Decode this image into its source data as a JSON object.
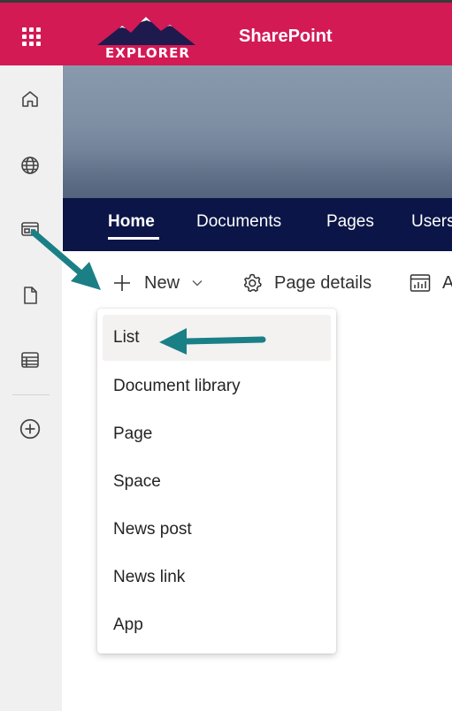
{
  "header": {
    "logo_text": "EXPLORER",
    "brand": "SharePoint",
    "accent_color": "#d31a55"
  },
  "app_rail": {
    "items": [
      {
        "icon": "home-icon"
      },
      {
        "icon": "globe-icon"
      },
      {
        "icon": "news-feed-icon"
      },
      {
        "icon": "file-icon"
      },
      {
        "icon": "lists-icon"
      },
      {
        "icon": "add-circle-icon"
      }
    ]
  },
  "nav": {
    "items": [
      {
        "label": "Home",
        "active": true
      },
      {
        "label": "Documents"
      },
      {
        "label": "Pages"
      },
      {
        "label": "Users"
      }
    ],
    "color": "#0b1547"
  },
  "command_bar": {
    "new_label": "New",
    "page_details_label": "Page details",
    "analytics_label": "Analytics"
  },
  "new_menu": {
    "items": [
      {
        "label": "List",
        "highlighted": true
      },
      {
        "label": "Document library"
      },
      {
        "label": "Page"
      },
      {
        "label": "Space"
      },
      {
        "label": "News post"
      },
      {
        "label": "News link"
      },
      {
        "label": "App"
      }
    ]
  },
  "annotation": {
    "arrow_color": "#1b7f86"
  }
}
